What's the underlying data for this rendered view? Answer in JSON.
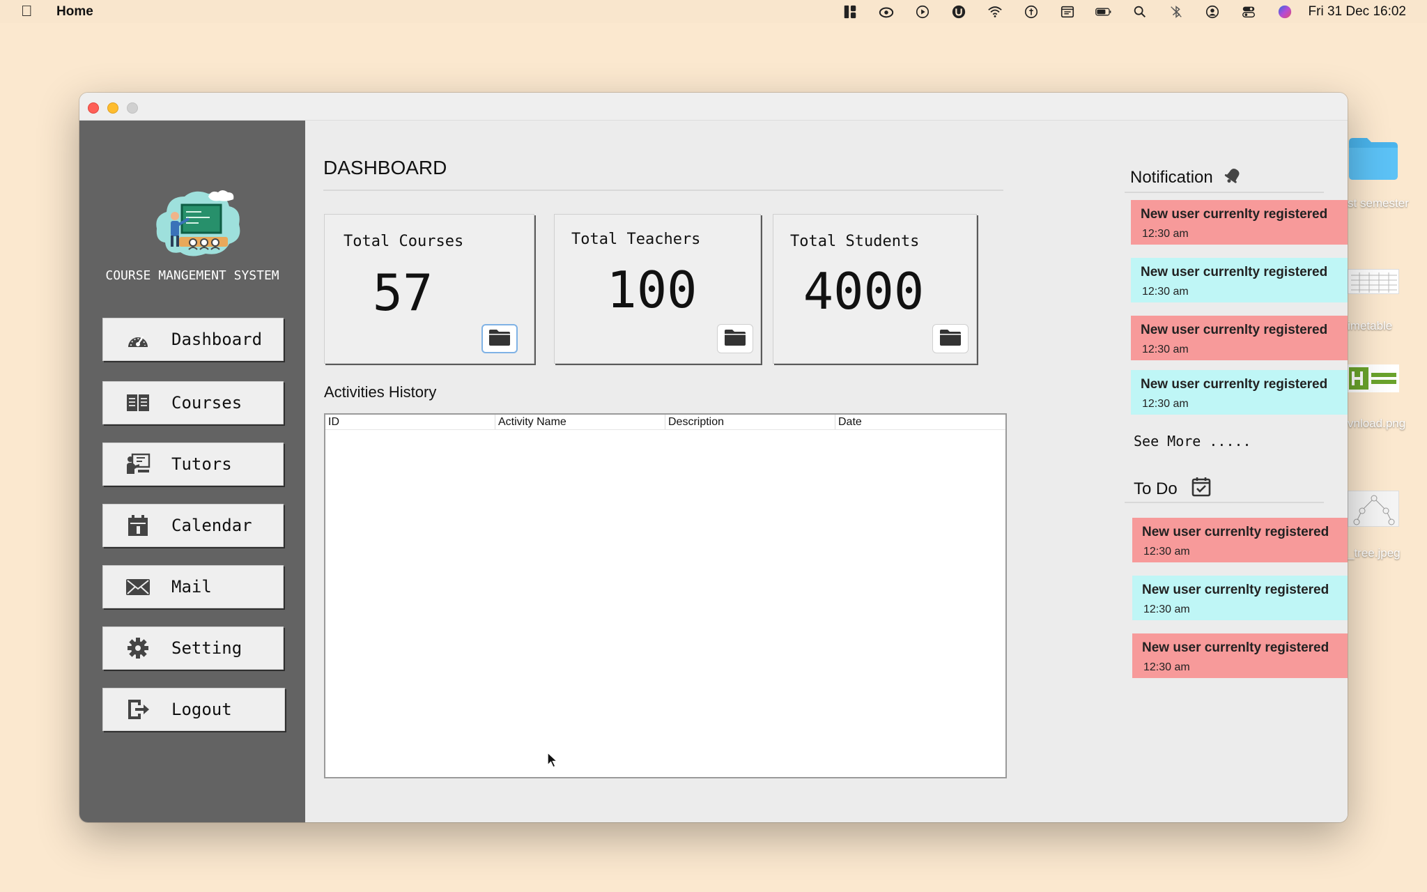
{
  "menubar": {
    "app_name": "Home",
    "datetime": "Fri 31 Dec  16:02"
  },
  "desktop": {
    "items": [
      {
        "label": "st semester"
      },
      {
        "label": "imetable"
      },
      {
        "label": "vnload.png"
      },
      {
        "label": "_tree.jpeg"
      }
    ]
  },
  "sidebar": {
    "app_title": "COURSE MANGEMENT SYSTEM",
    "items": [
      {
        "label": "Dashboard",
        "icon": "speedometer-icon"
      },
      {
        "label": "Courses",
        "icon": "book-icon"
      },
      {
        "label": "Tutors",
        "icon": "tutor-icon"
      },
      {
        "label": "Calendar",
        "icon": "calendar-icon"
      },
      {
        "label": "Mail",
        "icon": "mail-icon"
      },
      {
        "label": "Setting",
        "icon": "gear-icon"
      },
      {
        "label": "Logout",
        "icon": "logout-icon"
      }
    ]
  },
  "main": {
    "title": "DASHBOARD",
    "cards": [
      {
        "label": "Total Courses",
        "value": "57"
      },
      {
        "label": "Total Teachers",
        "value": "100"
      },
      {
        "label": "Total Students",
        "value": "4000"
      }
    ],
    "activities": {
      "title": "Activities History",
      "columns": [
        "ID",
        "Activity Name",
        "Description",
        "Date"
      ],
      "rows": []
    }
  },
  "notifications": {
    "title": "Notification",
    "items": [
      {
        "text": "New user currenlty registered",
        "time": "12:30 am",
        "color": "#f79a9a"
      },
      {
        "text": "New user currenlty registered",
        "time": "12:30 am",
        "color": "#bff6f6"
      },
      {
        "text": "New user currenlty registered",
        "time": "12:30 am",
        "color": "#f79a9a"
      },
      {
        "text": "New user currenlty registered",
        "time": "12:30 am",
        "color": "#bff6f6"
      }
    ],
    "see_more": "See More ....."
  },
  "todo": {
    "title": "To Do",
    "items": [
      {
        "text": "New user currenlty registered",
        "time": "12:30 am",
        "color": "#f79a9a"
      },
      {
        "text": "New user currenlty registered",
        "time": "12:30 am",
        "color": "#bff6f6"
      },
      {
        "text": "New user currenlty registered",
        "time": "12:30 am",
        "color": "#f79a9a"
      }
    ]
  }
}
